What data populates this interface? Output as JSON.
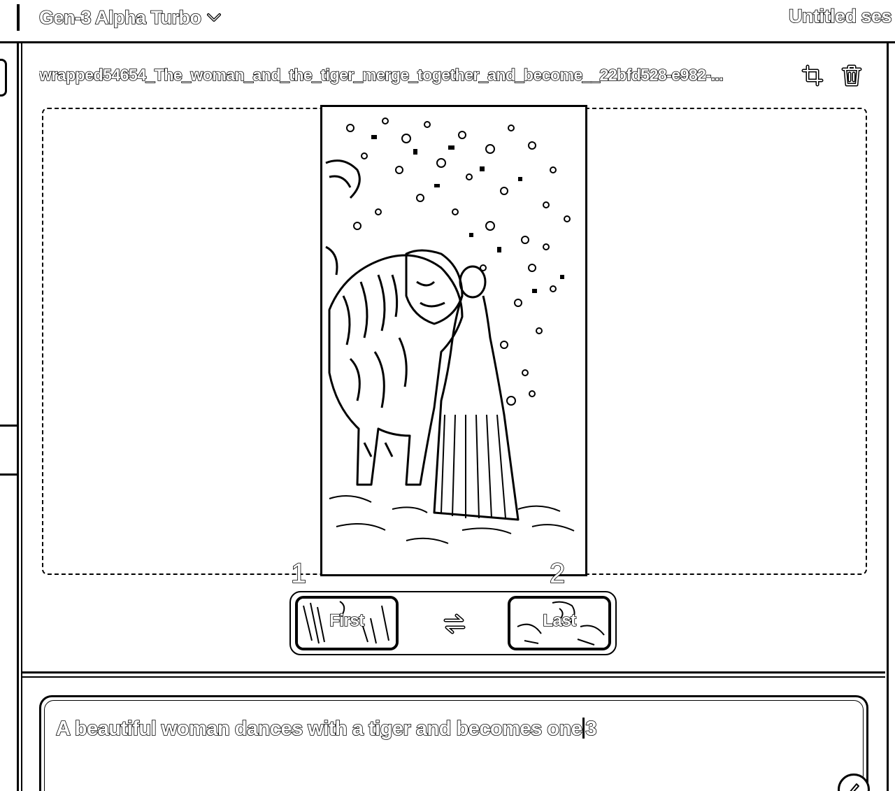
{
  "header": {
    "model_name": "Gen-3 Alpha Turbo",
    "model_dropdown_icon": "chevron-down-icon",
    "session_title": "Untitled ses"
  },
  "asset": {
    "file_name": "wrapped54654_The_woman_and_the_tiger_merge_together_and_become__22bfd528-e982-...",
    "crop_icon": "crop-icon",
    "delete_icon": "trash-icon"
  },
  "preview": {
    "image_subject": "woman-and-tiger-photo",
    "marker_first": "1",
    "marker_last": "2"
  },
  "keyframes": {
    "first_label": "First",
    "last_label": "Last",
    "swap_icon": "swap-arrows-icon"
  },
  "prompt": {
    "text": "A beautiful woman dances with a tiger and becomes one",
    "marker": "3",
    "assist_icon": "pencil-icon"
  }
}
